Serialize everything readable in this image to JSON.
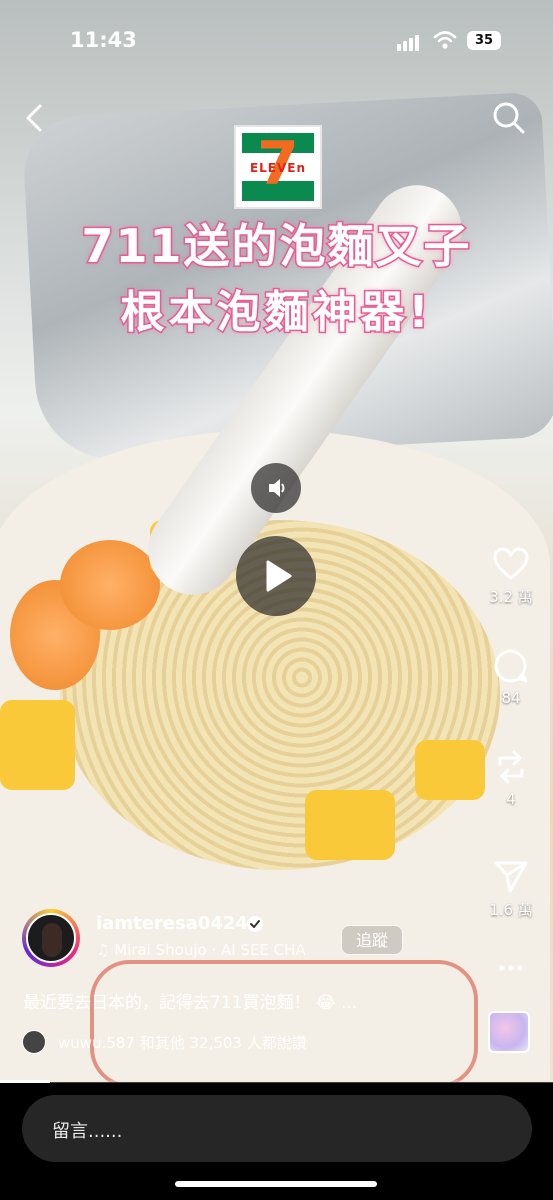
{
  "status_bar": {
    "time": "11:43",
    "battery": "35"
  },
  "video_overlay": {
    "logo_text": "ELEVEn",
    "logo_number": "7",
    "headline_line1": "711送的泡麵叉子",
    "headline_line2": "根本泡麵神器!"
  },
  "actions": {
    "likes": "3.2 萬",
    "comments": "84",
    "reposts": "4",
    "shares": "1.6 萬"
  },
  "post": {
    "username": "iamteresa0424",
    "music": "Mirai Shoujo · AI SEE CHA",
    "follow_label": "追蹤",
    "caption": "最近要去日本的，記得去711買泡麵！ 😂 ...",
    "liked_by": "wuwu.587 和其他 32,503 人都說讚"
  },
  "comment_input": {
    "placeholder": "留言......"
  },
  "playback": {
    "progress": 0.09
  }
}
